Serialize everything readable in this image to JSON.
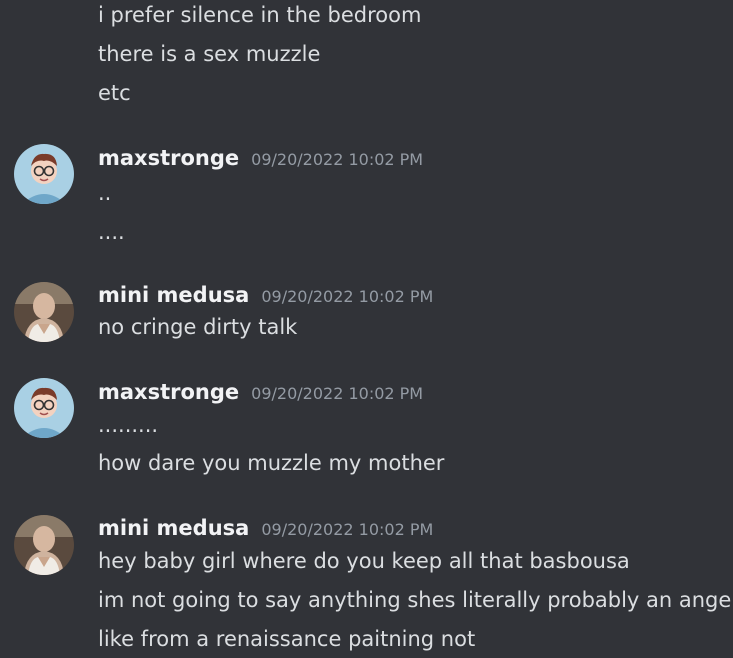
{
  "messages": [
    {
      "lines": [
        "i prefer silence in the bedroom",
        "there is a sex muzzle",
        "etc"
      ]
    },
    {
      "author": "maxstronge",
      "timestamp": "09/20/2022 10:02 PM",
      "avatar": "cartoon-avatar-with-glasses",
      "lines": [
        "..",
        "...."
      ]
    },
    {
      "author": "mini medusa",
      "timestamp": "09/20/2022 10:02 PM",
      "avatar": "photo-avatar-bald-person",
      "lines": [
        "no cringe dirty talk"
      ]
    },
    {
      "author": "maxstronge",
      "timestamp": "09/20/2022 10:02 PM",
      "avatar": "cartoon-avatar-with-glasses",
      "lines": [
        ".........",
        "how dare you muzzle my mother"
      ]
    },
    {
      "author": "mini medusa",
      "timestamp": "09/20/2022 10:02 PM",
      "avatar": "photo-avatar-bald-person",
      "lines": [
        "hey baby girl where do you keep all that basbousa",
        "im not going to say anything shes literally probably an angel",
        "like from a renaissance paitning not"
      ]
    }
  ],
  "colors": {
    "background": "#313338",
    "text": "#dbdee1",
    "username": "#f2f3f5",
    "timestamp": "#949ba4"
  }
}
